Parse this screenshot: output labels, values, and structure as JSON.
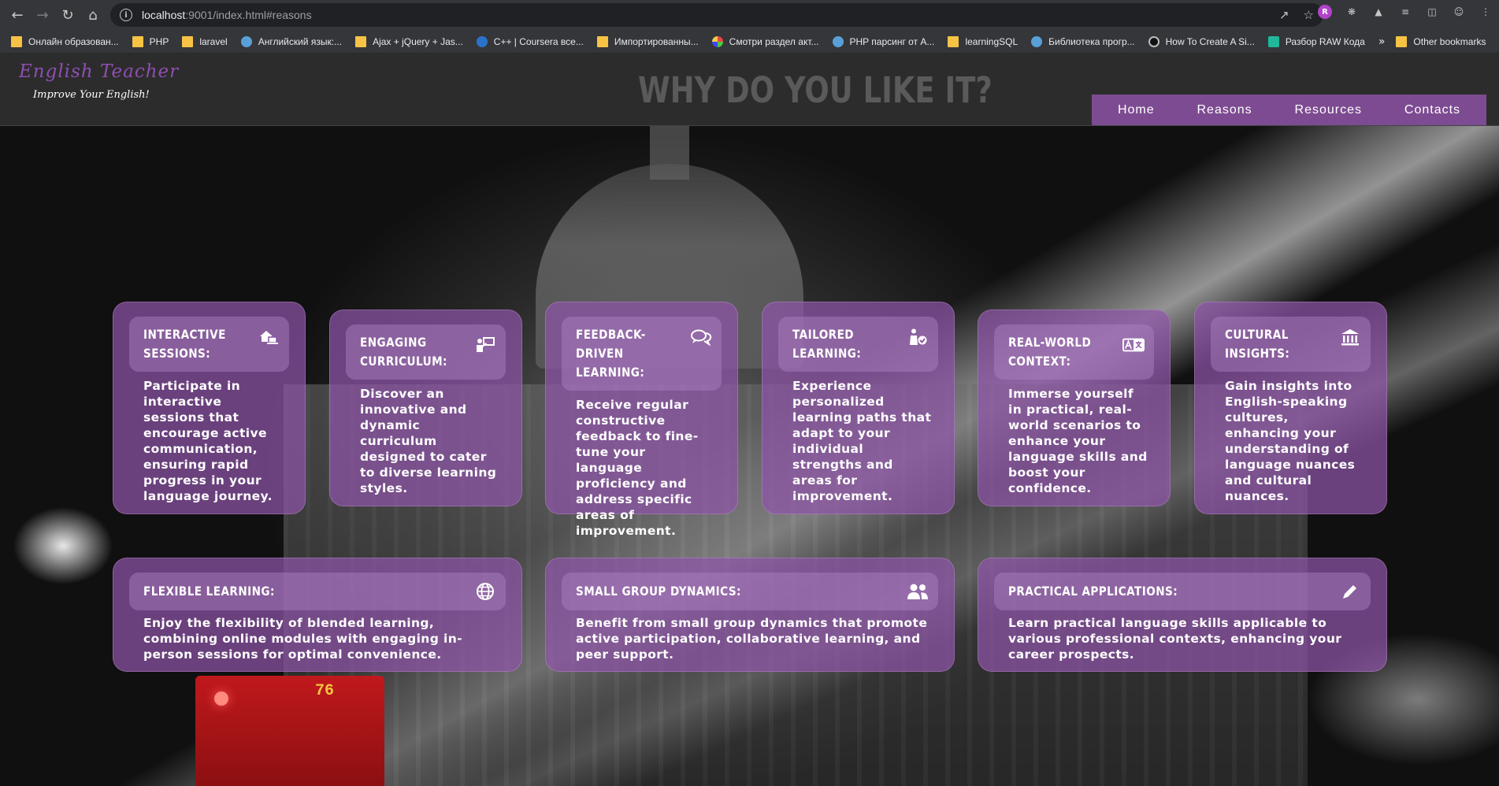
{
  "browser": {
    "url_host": "localhost",
    "url_rest": ":9001/index.html#reasons",
    "bookmarks": [
      {
        "label": "Онлайн образован...",
        "icon": "folder-icon"
      },
      {
        "label": "PHP",
        "icon": "folder-icon"
      },
      {
        "label": "laravel",
        "icon": "folder-icon"
      },
      {
        "label": "Английский язык:...",
        "icon": "globe-icon"
      },
      {
        "label": "Ajax + jQuery + Jas...",
        "icon": "folder-icon"
      },
      {
        "label": "C++ | Coursera все...",
        "icon": "coursera-icon"
      },
      {
        "label": "Импортированны...",
        "icon": "folder-icon"
      },
      {
        "label": "Смотри раздел акт...",
        "icon": "multicolor-icon"
      },
      {
        "label": "PHP парсинг от A...",
        "icon": "globe-icon"
      },
      {
        "label": "learningSQL",
        "icon": "folder-icon"
      },
      {
        "label": "Библиотека прогр...",
        "icon": "globe-icon"
      },
      {
        "label": "How To Create A Si...",
        "icon": "dark-icon"
      },
      {
        "label": "Разбор RAW Кода",
        "icon": "green-icon"
      }
    ],
    "more_label": "»",
    "other_bookmarks": "Other bookmarks"
  },
  "header": {
    "logo": "English Teacher",
    "tagline": "Improve Your English!",
    "title": "WHY DO YOU LIKE IT?",
    "nav": [
      "Home",
      "Reasons",
      "Resources",
      "Contacts"
    ]
  },
  "background": {
    "bus_number": "76"
  },
  "cards": [
    {
      "title": "Interactive Sessions:",
      "icon": "home-laptop-icon",
      "text": "Participate in interactive sessions that encourage active communication, ensuring rapid progress in your language journey."
    },
    {
      "title": "Engaging Curriculum:",
      "icon": "teacher-board-icon",
      "text": "Discover an innovative and dynamic curriculum designed to cater to diverse learning styles."
    },
    {
      "title": "Feedback-Driven Learning:",
      "icon": "chat-bubbles-icon",
      "text": "Receive regular constructive feedback to fine-tune your language proficiency and address specific areas of improvement."
    },
    {
      "title": "Tailored Learning:",
      "icon": "person-check-icon",
      "text": "Experience personalized learning paths that adapt to your individual strengths and areas for improvement."
    },
    {
      "title": "Real-World Context:",
      "icon": "translate-icon",
      "text": "Immerse yourself in practical, real-world scenarios to enhance your language skills and boost your confidence."
    },
    {
      "title": "Cultural Insights:",
      "icon": "museum-icon",
      "text": "Gain insights into English-speaking cultures, enhancing your understanding of language nuances and cultural nuances."
    },
    {
      "title": "Flexible Learning:",
      "icon": "globe-icon",
      "text": "Enjoy the flexibility of blended learning, combining online modules with engaging in-person sessions for optimal convenience."
    },
    {
      "title": "Small Group Dynamics:",
      "icon": "group-icon",
      "text": "Benefit from small group dynamics that promote active participation, collaborative learning, and peer support."
    },
    {
      "title": "Practical Applications:",
      "icon": "pencil-icon",
      "text": "Learn practical language skills applicable to various professional contexts, enhancing your career prospects."
    }
  ],
  "colors": {
    "accent": "#8e4fb1",
    "nav_bg": "#7d4b91",
    "card_bg": "#8e55a8",
    "header_bg": "#2d2c2d"
  }
}
